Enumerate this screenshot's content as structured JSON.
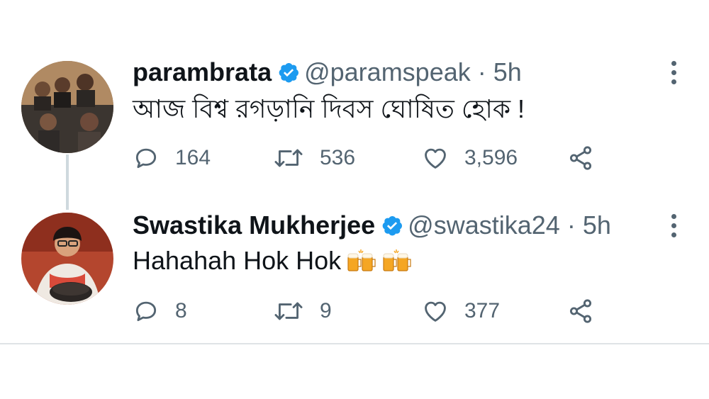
{
  "tweets": [
    {
      "name": "parambrata",
      "handle": "@paramspeak",
      "separator": "·",
      "time": "5h",
      "text": "আজ বিশ্ব রগড়ানি দিবস ঘোষিত হোক !",
      "replies": "164",
      "retweets": "536",
      "likes": "3,596"
    },
    {
      "name": "Swastika Mukherjee",
      "handle": "@swastika24",
      "separator": "·",
      "time": "5h",
      "text": "Hahahah Hok Hok",
      "emoji": "clinking-beer-mugs",
      "replies": "8",
      "retweets": "9",
      "likes": "377"
    }
  ],
  "colors": {
    "verified": "#1d9bf0",
    "secondary_text": "#536471",
    "thread_line": "#cfd9de"
  }
}
